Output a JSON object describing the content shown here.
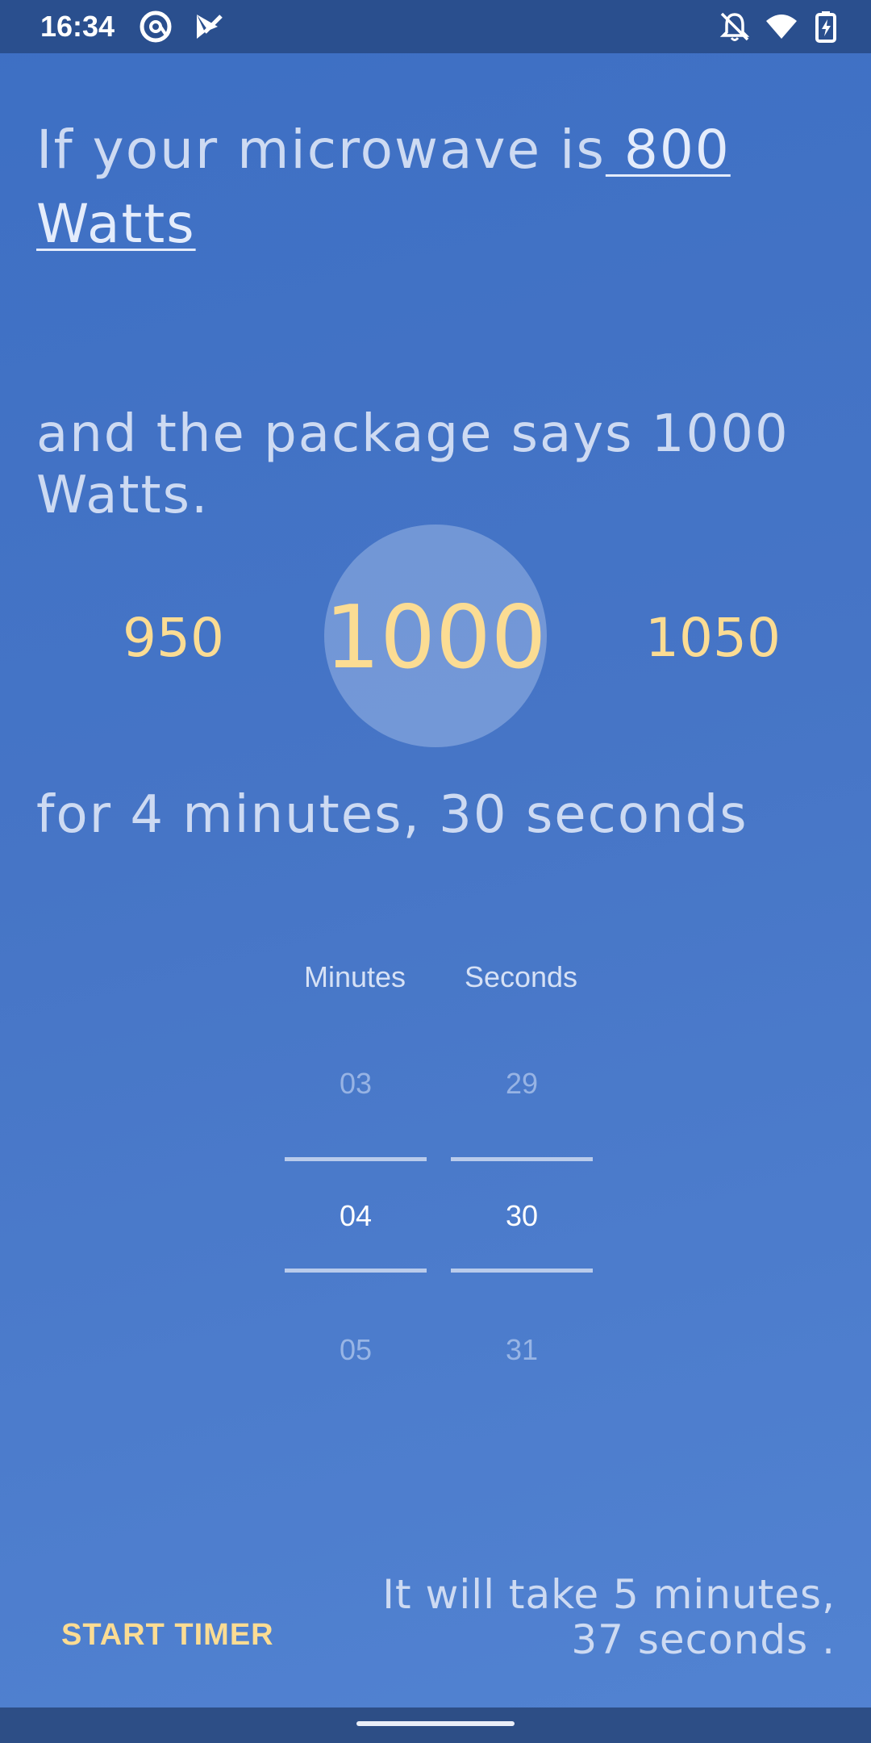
{
  "status_bar": {
    "time": "16:34",
    "left_icons": [
      "at-sign-icon",
      "play-store-icon"
    ],
    "right_icons": [
      "notifications-off-icon",
      "wifi-icon",
      "battery-charging-icon"
    ]
  },
  "question": {
    "line1_prefix": "If your microwave is",
    "microwave_watts": " 800 Watts",
    "line2": "and the package says 1000 Watts.",
    "line3": "for 4 minutes, 30 seconds"
  },
  "watt_picker": {
    "previous": "950",
    "current": "1000",
    "next": "1050"
  },
  "time_picker": {
    "minutes_label": "Minutes",
    "seconds_label": "Seconds",
    "minutes": {
      "above": "03",
      "selected": "04",
      "below": "05"
    },
    "seconds": {
      "above": "29",
      "selected": "30",
      "below": "31"
    }
  },
  "actions": {
    "start_timer": "START TIMER"
  },
  "result": {
    "text": "It will take 5 minutes, 37 seconds ."
  },
  "colors": {
    "accent": "#fbdc93",
    "background": "#4675c6",
    "text": "#cddaf2"
  }
}
